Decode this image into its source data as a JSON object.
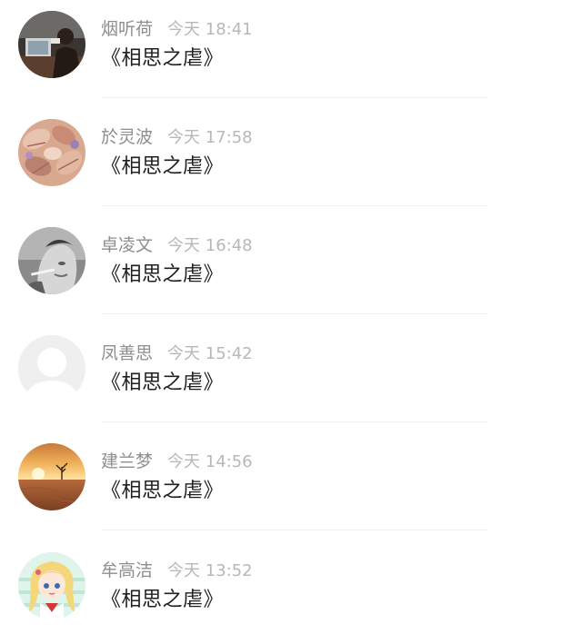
{
  "comments": [
    {
      "name": "烟听荷",
      "time": "今天 18:41",
      "text": "《相思之虐》",
      "avatar_icon": "avatar-photo-icon"
    },
    {
      "name": "於灵波",
      "time": "今天 17:58",
      "text": "《相思之虐》",
      "avatar_icon": "avatar-seashells-icon"
    },
    {
      "name": "卓凌文",
      "time": "今天 16:48",
      "text": "《相思之虐》",
      "avatar_icon": "avatar-smoking-man-icon"
    },
    {
      "name": "凤善思",
      "time": "今天 15:42",
      "text": "《相思之虐》",
      "avatar_icon": "avatar-default-icon"
    },
    {
      "name": "建兰梦",
      "time": "今天 14:56",
      "text": "《相思之虐》",
      "avatar_icon": "avatar-desert-sunset-icon"
    },
    {
      "name": "牟高洁",
      "time": "今天 13:52",
      "text": "《相思之虐》",
      "avatar_icon": "avatar-anime-girl-icon"
    }
  ],
  "colors": {
    "name": "#8e8e8e",
    "time": "#b8b8b8",
    "text": "#1f1f1f",
    "divider": "#efefef"
  }
}
